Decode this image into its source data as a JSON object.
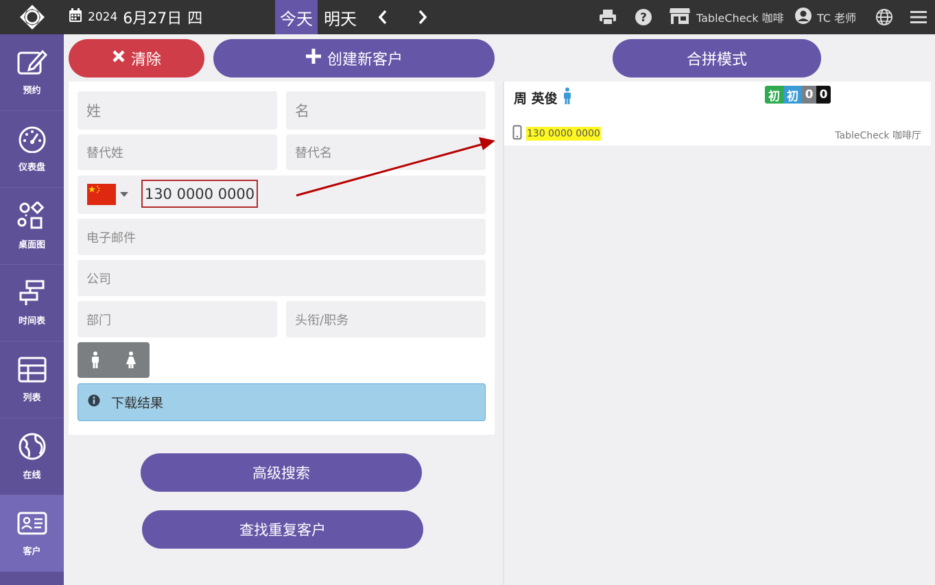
{
  "topbar": {
    "date_year": "2024",
    "date_main": "6月27日",
    "date_weekday": "四",
    "today_label": "今天",
    "tomorrow_label": "明天",
    "venue_name": "TableCheck 咖啡",
    "user_name": "TC 老师"
  },
  "sidebar": {
    "items": [
      {
        "label": "预约"
      },
      {
        "label": "仪表盘"
      },
      {
        "label": "桌面图"
      },
      {
        "label": "时间表"
      },
      {
        "label": "列表"
      },
      {
        "label": "在线"
      },
      {
        "label": "客户"
      }
    ]
  },
  "actions": {
    "clear_label": "清除",
    "create_label": "创建新客户",
    "merge_label": "合拼模式",
    "advanced_search_label": "高级搜索",
    "find_duplicates_label": "查找重复客户"
  },
  "form": {
    "last_name_placeholder": "姓",
    "first_name_placeholder": "名",
    "alt_last_name_placeholder": "替代姓",
    "alt_first_name_placeholder": "替代名",
    "phone_value": "130 0000 0000",
    "email_placeholder": "电子邮件",
    "company_placeholder": "公司",
    "department_placeholder": "部门",
    "title_placeholder": "头衔/职务",
    "info_text": "下载结果"
  },
  "results": [
    {
      "name": "周 英俊",
      "badges": [
        "初",
        "初",
        "0",
        "0"
      ],
      "phone": "130 0000 0000",
      "venue": "TableCheck 咖啡厅"
    }
  ],
  "colors": {
    "primary": "#6556a8",
    "danger": "#cf3d48",
    "topbar": "#333333",
    "sidebar": "#5e5198",
    "highlight": "#fff720"
  }
}
